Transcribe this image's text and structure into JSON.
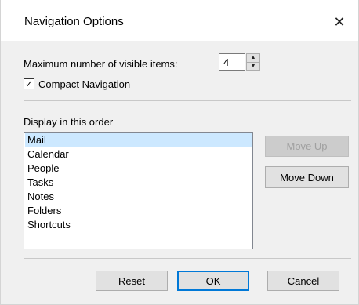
{
  "window": {
    "title": "Navigation Options",
    "close_glyph": "✕"
  },
  "max_items": {
    "label": "Maximum number of visible items:",
    "value": "4",
    "up_glyph": "▲",
    "down_glyph": "▼"
  },
  "compact": {
    "label": "Compact Navigation",
    "checked": true,
    "check_glyph": "✓"
  },
  "order": {
    "label": "Display in this order",
    "items": [
      "Mail",
      "Calendar",
      "People",
      "Tasks",
      "Notes",
      "Folders",
      "Shortcuts"
    ],
    "selected": "Mail"
  },
  "buttons": {
    "move_up": "Move Up",
    "move_down": "Move Down",
    "reset": "Reset",
    "ok": "OK",
    "cancel": "Cancel"
  }
}
